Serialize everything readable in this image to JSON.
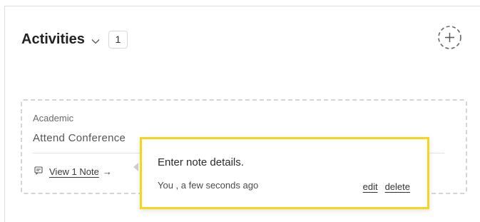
{
  "header": {
    "title": "Activities",
    "count": "1",
    "expand_icon": "chevron-down-icon",
    "add_icon": "plus-circle-dashed-icon"
  },
  "activity_card": {
    "category": "Academic",
    "title": "Attend Conference",
    "view_notes_label": "View 1 Note",
    "arrow": "→",
    "note_icon": "note-icon"
  },
  "note_popover": {
    "text": "Enter note details.",
    "meta": "You , a few seconds ago",
    "edit_label": "edit",
    "delete_label": "delete",
    "highlight_color": "#f7d51d"
  }
}
